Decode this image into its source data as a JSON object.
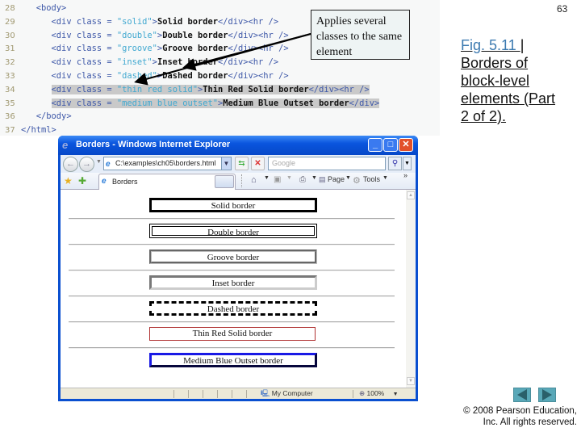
{
  "slide": {
    "number": "63",
    "caption": {
      "figure_link": "Fig. 5.11 ",
      "separator": "| ",
      "title": "Borders of block-level elements (Part 2 of 2)."
    },
    "callout": "Applies several classes to the same element",
    "copyright_line1": "© 2008 Pearson Education,",
    "copyright_line2": "Inc.  All rights reserved.",
    "nav": {
      "prev_icon": "prev-slide-icon",
      "next_icon": "next-slide-icon"
    }
  },
  "code": {
    "lines": [
      {
        "num": "28",
        "indent": "   ",
        "parts": [
          [
            "tag",
            "<body>"
          ]
        ]
      },
      {
        "num": "29",
        "indent": "      ",
        "parts": [
          [
            "tag",
            "<div class = "
          ],
          [
            "str",
            "\"solid\""
          ],
          [
            "tag",
            ">"
          ],
          [
            "txt",
            "Solid border"
          ],
          [
            "tag",
            "</div><hr />"
          ]
        ]
      },
      {
        "num": "30",
        "indent": "      ",
        "parts": [
          [
            "tag",
            "<div class = "
          ],
          [
            "str",
            "\"double\""
          ],
          [
            "tag",
            ">"
          ],
          [
            "txt",
            "Double border"
          ],
          [
            "tag",
            "</div><hr />"
          ]
        ]
      },
      {
        "num": "31",
        "indent": "      ",
        "parts": [
          [
            "tag",
            "<div class = "
          ],
          [
            "str",
            "\"groove\""
          ],
          [
            "tag",
            ">"
          ],
          [
            "txt",
            "Groove border"
          ],
          [
            "tag",
            "</div><hr />"
          ]
        ]
      },
      {
        "num": "32",
        "indent": "      ",
        "parts": [
          [
            "tag",
            "<div class = "
          ],
          [
            "str",
            "\"inset\""
          ],
          [
            "tag",
            ">"
          ],
          [
            "txt",
            "Inset border"
          ],
          [
            "tag",
            "</div><hr />"
          ]
        ]
      },
      {
        "num": "33",
        "indent": "      ",
        "parts": [
          [
            "tag",
            "<div class = "
          ],
          [
            "str",
            "\"dashed\""
          ],
          [
            "tag",
            ">"
          ],
          [
            "txt",
            "Dashed border"
          ],
          [
            "tag",
            "</div><hr />"
          ]
        ]
      },
      {
        "num": "34",
        "indent": "      ",
        "highlight": true,
        "parts": [
          [
            "tag",
            "<div class = "
          ],
          [
            "str",
            "\"thin red solid\""
          ],
          [
            "tag",
            ">"
          ],
          [
            "txt",
            "Thin Red Solid border"
          ],
          [
            "tag",
            "</div><hr />"
          ]
        ]
      },
      {
        "num": "35",
        "indent": "      ",
        "highlight": true,
        "parts": [
          [
            "tag",
            "<div class = "
          ],
          [
            "str",
            "\"medium blue outset\""
          ],
          [
            "tag",
            ">"
          ],
          [
            "txt",
            "Medium Blue Outset border"
          ],
          [
            "tag",
            "</div>"
          ]
        ]
      },
      {
        "num": "36",
        "indent": "   ",
        "parts": [
          [
            "tag",
            "</body>"
          ]
        ]
      },
      {
        "num": "37",
        "indent": "",
        "parts": [
          [
            "tag",
            "</html>"
          ]
        ]
      }
    ]
  },
  "browser": {
    "title": "Borders - Windows Internet Explorer",
    "window_buttons": {
      "minimize": "_",
      "maximize": "□",
      "close": "✕"
    },
    "address": "C:\\examples\\ch05\\borders.html",
    "search_placeholder": "Google",
    "tab_label": "Borders",
    "commands": {
      "page": "Page",
      "tools": "Tools",
      "more": "»"
    },
    "boxes": [
      {
        "label": "Solid border",
        "style": "solid"
      },
      {
        "label": "Double border",
        "style": "double"
      },
      {
        "label": "Groove border",
        "style": "groove"
      },
      {
        "label": "Inset border",
        "style": "inset"
      },
      {
        "label": "Dashed border",
        "style": "dashed"
      },
      {
        "label": "Thin Red Solid border",
        "style": "thin red solid"
      },
      {
        "label": "Medium Blue Outset border",
        "style": "medium blue outset"
      }
    ],
    "status": {
      "zone": "My Computer",
      "zoom": "100%"
    }
  },
  "colors": {
    "caption_link": "#3c7ab0",
    "code_tag": "#3e58a8",
    "code_string": "#40a8d0",
    "highlight": "#c9c9c9",
    "red_border": "#b03030",
    "blue_border": "#101090",
    "nav_button": "#59a8b8",
    "ie_titlebar": "#0a55de"
  }
}
